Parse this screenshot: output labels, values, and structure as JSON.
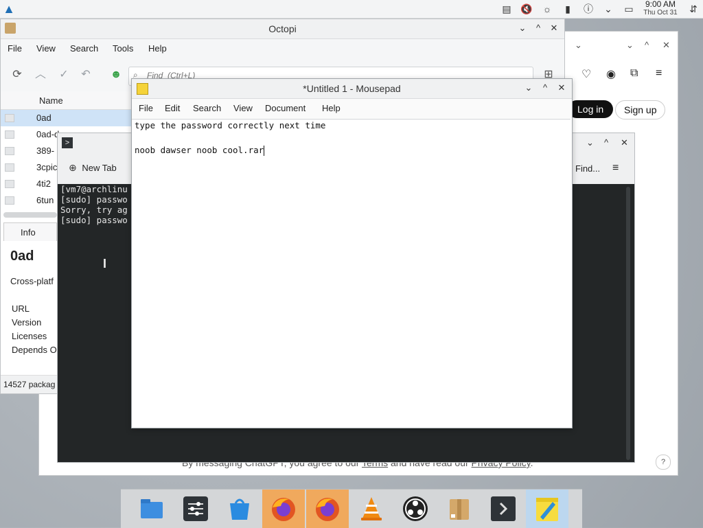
{
  "top_panel": {
    "clock_time": "9:00 AM",
    "clock_date": "Thu Oct 31",
    "tray_icons": [
      "clipboard-icon",
      "speaker-muted-icon",
      "brightness-icon",
      "battery-icon",
      "network-icon",
      "chevron-down-icon",
      "desktop-icon"
    ]
  },
  "browser": {
    "login_label": "Log in",
    "signup_label": "Sign up",
    "footer_prefix": "By messaging ChatGPT, you agree to our ",
    "footer_terms": "Terms",
    "footer_mid": " and have read our ",
    "footer_privacy": "Privacy Policy",
    "footer_end": ".",
    "help_label": "?"
  },
  "octopi": {
    "title": "Octopi",
    "menu": [
      "File",
      "View",
      "Search",
      "Tools",
      "Help"
    ],
    "find_placeholder": "Find  (Ctrl+L)",
    "column_name": "Name",
    "packages": [
      "0ad",
      "0ad-d",
      "389-",
      "3cpic",
      "4ti2",
      "6tun"
    ],
    "info_tab": "Info",
    "info_title": "0ad",
    "info_desc": "Cross-platf",
    "info_fields": [
      "URL",
      "Version",
      "Licenses",
      "Depends O"
    ],
    "status": "14527 packag"
  },
  "terminal": {
    "new_tab_label": "New Tab",
    "find_label": "Find...",
    "lines": [
      "[vm7@archlinu",
      "[sudo] passwo",
      "Sorry, try ag",
      "[sudo] passwo"
    ]
  },
  "mousepad": {
    "title": "*Untitled 1 - Mousepad",
    "menu": [
      "File",
      "Edit",
      "Search",
      "View",
      "Document",
      "Help"
    ],
    "lines": [
      "type the password correctly next time",
      "",
      "noob dawser noob cool.rar"
    ]
  },
  "dock": {
    "items": [
      "file-manager-icon",
      "settings-icon",
      "software-store-icon",
      "firefox-icon",
      "firefox-icon",
      "vlc-icon",
      "obs-icon",
      "package-icon",
      "terminal-icon",
      "mousepad-icon"
    ]
  }
}
